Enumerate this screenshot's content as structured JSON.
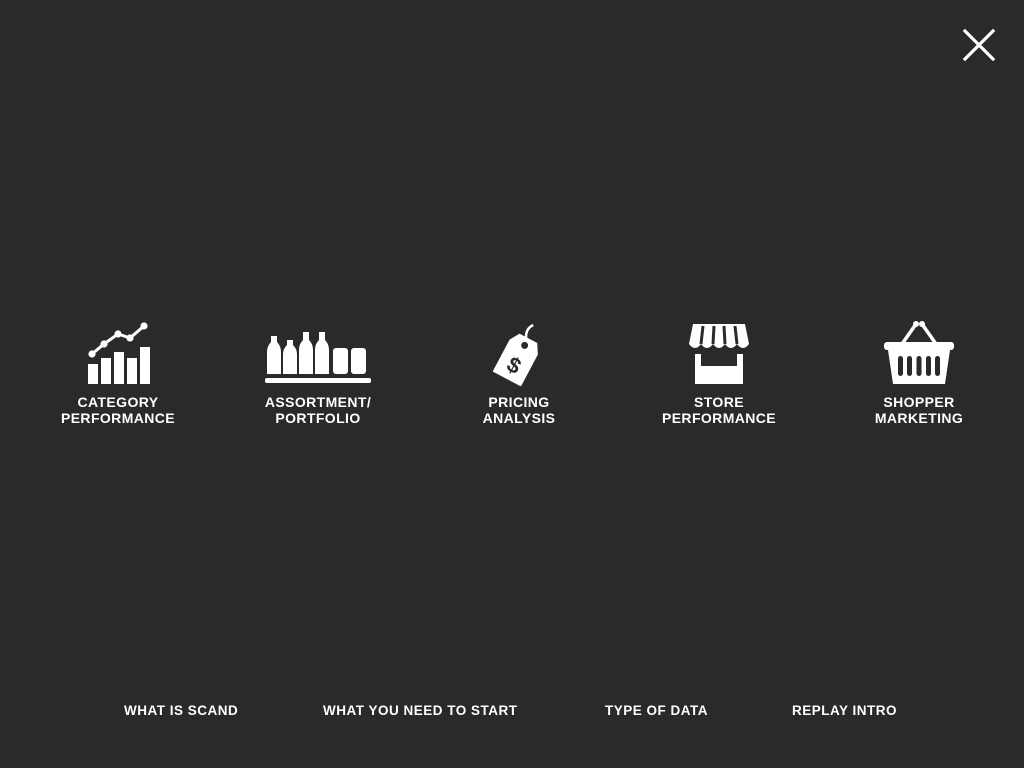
{
  "close": {
    "icon": "close-icon"
  },
  "tiles": [
    {
      "icon": "bar-chart-trend-icon",
      "line1": "CATEGORY",
      "line2": "PERFORMANCE"
    },
    {
      "icon": "bottles-shelf-icon",
      "line1": "ASSORTMENT/",
      "line2": "PORTFOLIO"
    },
    {
      "icon": "price-tag-icon",
      "line1": "PRICING",
      "line2": "ANALYSIS"
    },
    {
      "icon": "storefront-icon",
      "line1": "STORE",
      "line2": "PERFORMANCE"
    },
    {
      "icon": "shopping-basket-icon",
      "line1": "SHOPPER",
      "line2": "MARKETING"
    }
  ],
  "footer": {
    "what_is": "WHAT IS SCAND",
    "what_you_need": "WHAT YOU NEED TO START",
    "type_of_data": "TYPE OF DATA",
    "replay_intro": "REPLAY INTRO"
  },
  "colors": {
    "background": "#2a2a2a",
    "foreground": "#ffffff"
  }
}
